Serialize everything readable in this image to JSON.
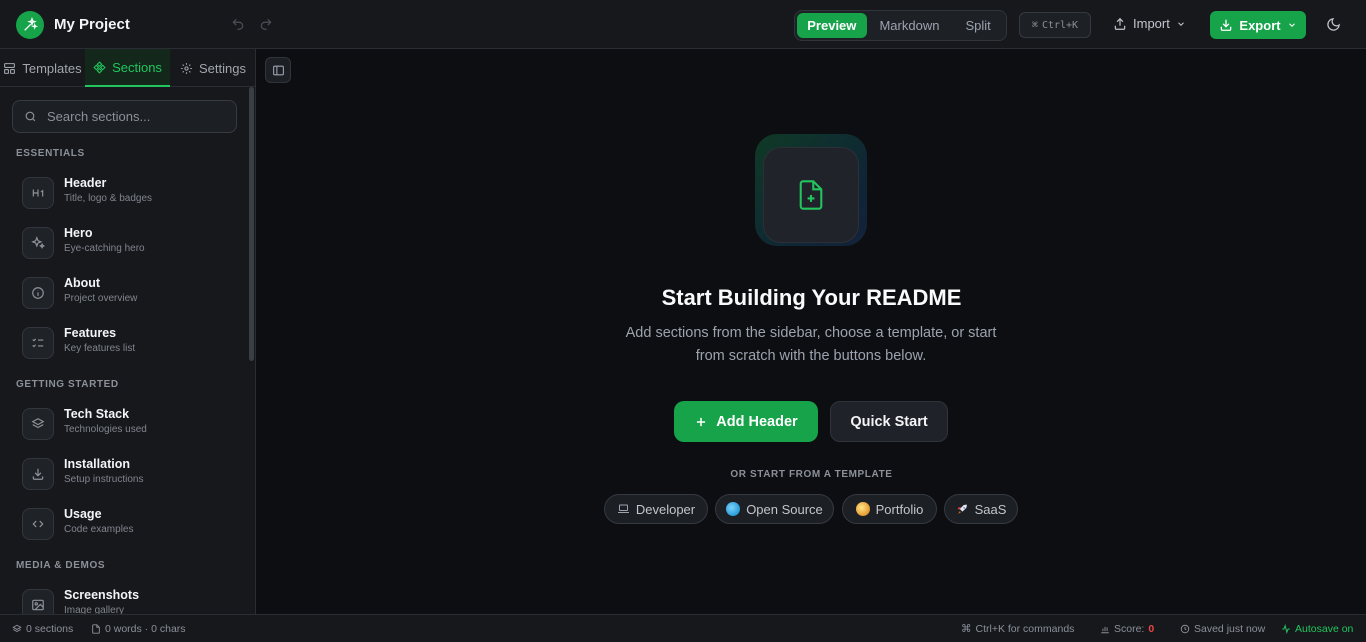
{
  "header": {
    "project_name": "My Project",
    "views": [
      "Preview",
      "Markdown",
      "Split"
    ],
    "active_view": "Preview",
    "shortcut": "Ctrl+K",
    "shortcut_symbol": "⌘",
    "import_label": "Import",
    "export_label": "Export"
  },
  "sidebar": {
    "tabs": [
      "Templates",
      "Sections",
      "Settings"
    ],
    "active_tab": "Sections",
    "search_placeholder": "Search sections...",
    "categories": [
      {
        "name": "ESSENTIALS",
        "items": [
          {
            "title": "Header",
            "subtitle": "Title, logo & badges",
            "icon": "heading-icon"
          },
          {
            "title": "Hero",
            "subtitle": "Eye-catching hero",
            "icon": "sparkles-icon"
          },
          {
            "title": "About",
            "subtitle": "Project overview",
            "icon": "info-icon"
          },
          {
            "title": "Features",
            "subtitle": "Key features list",
            "icon": "checklist-icon"
          }
        ]
      },
      {
        "name": "GETTING STARTED",
        "items": [
          {
            "title": "Tech Stack",
            "subtitle": "Technologies used",
            "icon": "layers-icon"
          },
          {
            "title": "Installation",
            "subtitle": "Setup instructions",
            "icon": "download-icon"
          },
          {
            "title": "Usage",
            "subtitle": "Code examples",
            "icon": "code-icon"
          }
        ]
      },
      {
        "name": "MEDIA & DEMOS",
        "items": [
          {
            "title": "Screenshots",
            "subtitle": "Image gallery",
            "icon": "image-icon"
          }
        ]
      }
    ]
  },
  "main": {
    "title": "Start Building Your README",
    "subtitle": "Add sections from the sidebar, choose a template, or start from scratch with the buttons below.",
    "add_header_label": "Add Header",
    "quick_start_label": "Quick Start",
    "or_template_label": "OR START FROM A TEMPLATE",
    "templates": [
      {
        "label": "Developer",
        "icon": "laptop-icon"
      },
      {
        "label": "Open Source",
        "icon": "globe-icon"
      },
      {
        "label": "Portfolio",
        "icon": "palette-icon"
      },
      {
        "label": "SaaS",
        "icon": "rocket-icon"
      }
    ]
  },
  "status": {
    "sections": "0 sections",
    "words": "0 words · 0 chars",
    "commands": "Ctrl+K for commands",
    "score_label": "Score:",
    "score_value": "0",
    "saved": "Saved just now",
    "autosave": "Autosave on"
  },
  "colors": {
    "accent": "#16a34a",
    "accent_light": "#22c55e",
    "score": "#ef4444",
    "background": "#0d0e11",
    "panel": "#16181c"
  }
}
